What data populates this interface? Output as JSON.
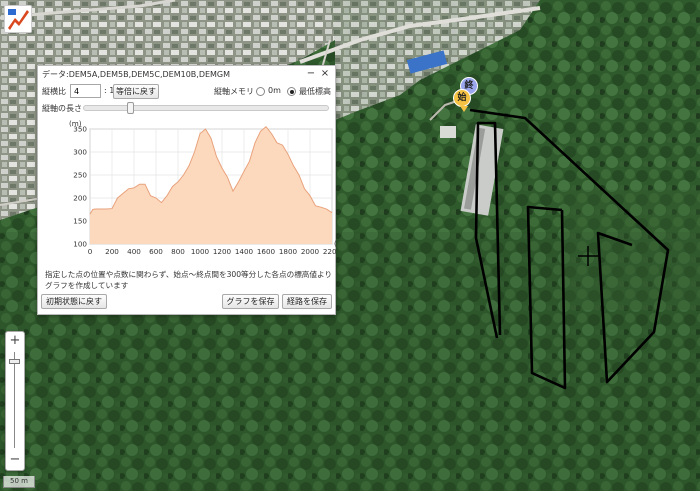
{
  "map": {
    "marker_end_label": "終",
    "marker_start_label": "始",
    "scale_label": "50 m"
  },
  "colors": {
    "route_line": "#000000",
    "marker_start": "#f5c243",
    "marker_end": "#9aa6ee",
    "profile_fill": "#fcd8bd",
    "profile_line": "#e8a27c"
  },
  "panel": {
    "title": "データ:DEM5A,DEM5B,DEM5C,DEM10B,DEMGM",
    "minimize_label": "−",
    "close_label": "×",
    "ratio_label": "縦横比",
    "ratio_value": "4",
    "ratio_suffix": ": 1",
    "equal_ratio_button": "等倍に戻す",
    "axis_memory_label": "縦軸メモリ",
    "radio_zero_label": "0m",
    "radio_min_label": "最低標高",
    "radio_selected": "min",
    "vertical_length_label": "縦軸の長さ",
    "vertical_length_fraction": 0.18,
    "note": "指定した点の位置や点数に関わらず、始点～終点間を300等分した各点の標高値よりグラフを作成しています",
    "reset_button": "初期状態に戻す",
    "save_graph_button": "グラフを保存",
    "save_route_button": "経路を保存"
  },
  "chart_data": {
    "type": "area",
    "x": [
      0,
      25,
      50,
      100,
      150,
      200,
      250,
      300,
      350,
      400,
      450,
      500,
      550,
      600,
      650,
      700,
      750,
      800,
      850,
      900,
      950,
      1000,
      1050,
      1100,
      1150,
      1200,
      1250,
      1300,
      1350,
      1400,
      1450,
      1500,
      1550,
      1600,
      1650,
      1700,
      1750,
      1800,
      1850,
      1900,
      1950,
      2000,
      2050,
      2100,
      2150,
      2200
    ],
    "y": [
      165,
      175,
      176,
      176,
      176,
      177,
      200,
      210,
      220,
      222,
      230,
      230,
      205,
      200,
      190,
      205,
      225,
      235,
      250,
      270,
      300,
      340,
      350,
      330,
      290,
      265,
      245,
      215,
      235,
      258,
      280,
      320,
      345,
      355,
      340,
      320,
      315,
      295,
      270,
      250,
      220,
      205,
      183,
      180,
      176,
      168
    ],
    "xlabel": "(m)",
    "ylabel": "(m)",
    "xlim": [
      0,
      2200
    ],
    "ylim": [
      100,
      350
    ],
    "xticks": [
      0,
      200,
      400,
      600,
      800,
      1000,
      1200,
      1400,
      1600,
      1800,
      2000,
      2200
    ],
    "yticks": [
      100,
      150,
      200,
      250,
      300,
      350
    ],
    "grid": true
  }
}
